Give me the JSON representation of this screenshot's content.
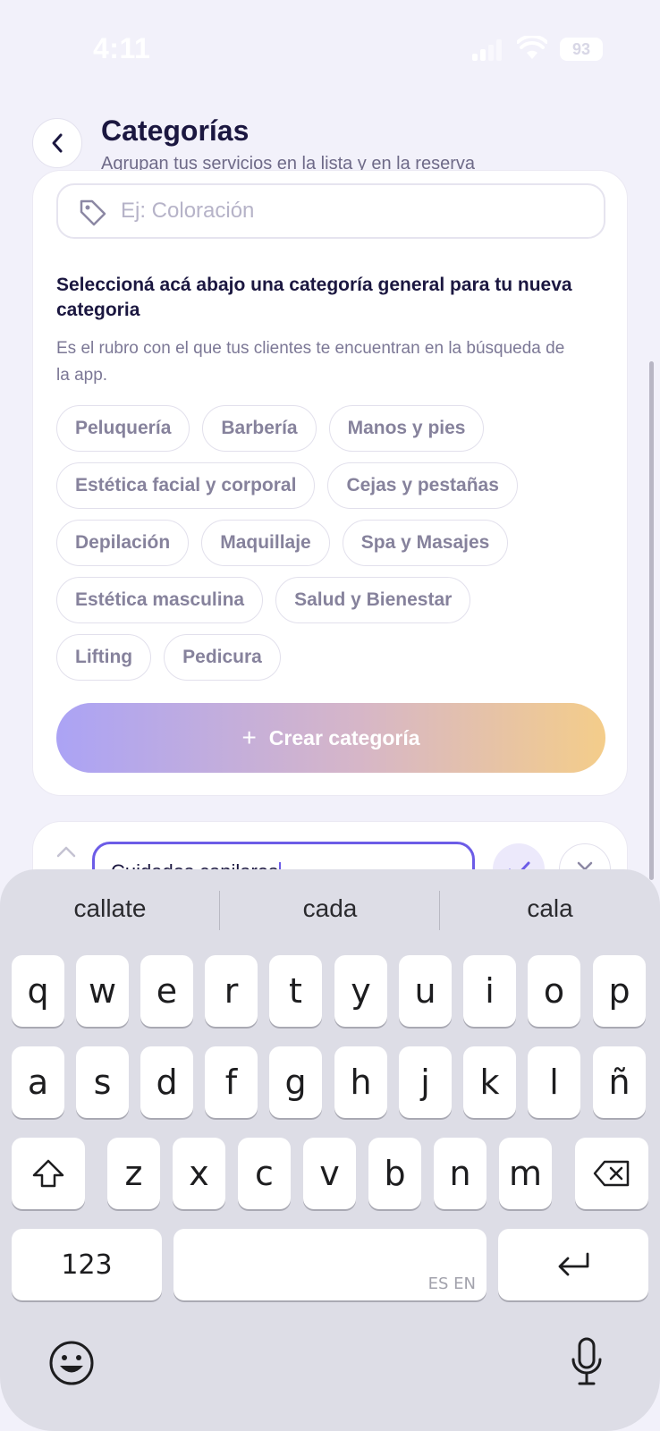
{
  "status_bar": {
    "time": "4:11",
    "battery": "93"
  },
  "header": {
    "title": "Categorías",
    "subtitle": "Agrupan tus servicios en la lista y en la reserva"
  },
  "new_category": {
    "name_placeholder": "Ej: Coloración",
    "section_title": "Seleccioná acá abajo una categoría general para tu nueva categoria",
    "section_description": "Es el rubro con el que tus clientes te encuentran en la búsqueda de la app.",
    "chip_rows": [
      [
        "Peluquería",
        "Barbería",
        "Manos y pies"
      ],
      [
        "Estética facial y corporal",
        "Cejas y pestañas"
      ],
      [
        "Depilación",
        "Maquillaje",
        "Spa y Masajes"
      ],
      [
        "Estética masculina",
        "Salud y Bienestar"
      ],
      [
        "Lifting",
        "Pedicura"
      ]
    ],
    "create_button": "Crear categoría"
  },
  "edit_category": {
    "value": "Cuidados capilares"
  },
  "keyboard": {
    "suggestions": [
      "callate",
      "cada",
      "cala"
    ],
    "row1": [
      "q",
      "w",
      "e",
      "r",
      "t",
      "y",
      "u",
      "i",
      "o",
      "p"
    ],
    "row2": [
      "a",
      "s",
      "d",
      "f",
      "g",
      "h",
      "j",
      "k",
      "l",
      "ñ"
    ],
    "row3": [
      "z",
      "x",
      "c",
      "v",
      "b",
      "n",
      "m"
    ],
    "numbers_key": "123",
    "space_language": "ES EN"
  },
  "colors": {
    "accent": "#6c5ce7",
    "gradient_start": "#aba3f5",
    "gradient_end": "#f4cd8a"
  }
}
